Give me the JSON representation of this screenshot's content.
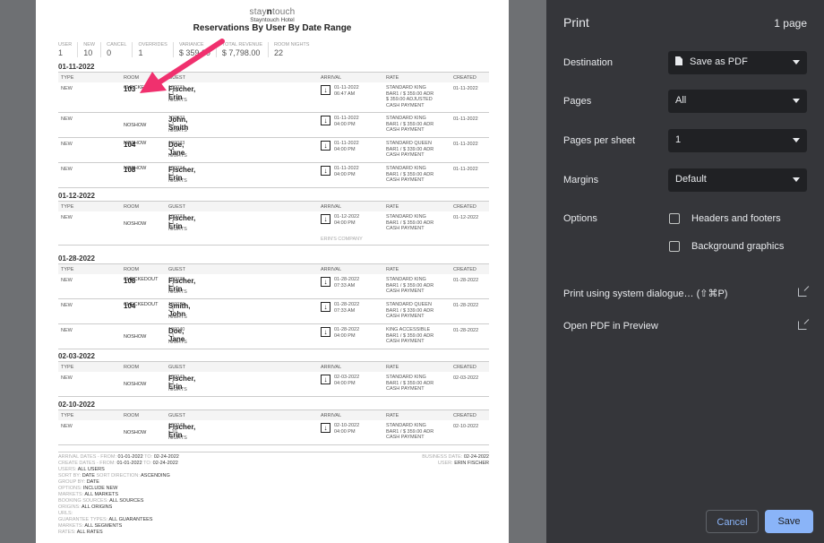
{
  "report": {
    "brand_prefix": "stay",
    "brand_mid": "n",
    "brand_suffix": "touch",
    "hotel": "Stayntouch Hotel",
    "title": "Reservations By User By Date Range"
  },
  "stats": [
    {
      "label": "USER",
      "value": "1"
    },
    {
      "label": "NEW",
      "value": "10"
    },
    {
      "label": "CANCEL",
      "value": "0"
    },
    {
      "label": "OVERRIDES",
      "value": "1"
    },
    {
      "label": "VARIANCE",
      "value": "$ 359.00"
    },
    {
      "label": "TOTAL REVENUE",
      "value": "$ 7,798.00"
    },
    {
      "label": "ROOM NIGHTS",
      "value": "22"
    }
  ],
  "columns": {
    "type": "TYPE",
    "room": "ROOM",
    "guest": "GUEST",
    "arrival": "ARRIVAL",
    "rate": "RATE",
    "created": "CREATED"
  },
  "sections": [
    {
      "date": "01-11-2022",
      "rows": [
        {
          "type": "NEW",
          "room": "103",
          "status": "CHECKEDOUT",
          "guest": "Fischer, Erin",
          "gid": "100031 • 1 NIGHTS",
          "arr_date": "01-11-2022",
          "arr_time": "06:47 AM",
          "rate": [
            "STANDARD KING",
            "BAR1 / $ 359.00 ADR",
            "$ 359.00 ADJUSTED",
            "CASH PAYMENT"
          ],
          "created": "01-11-2022"
        },
        {
          "type": "NEW",
          "room": "",
          "status": "NOSHOW",
          "guest": "John, Smith",
          "gid": "100032 • 1 NIGHTS",
          "arr_date": "01-11-2022",
          "arr_time": "04:00 PM",
          "rate": [
            "STANDARD KING",
            "BAR1 / $ 359.00 ADR",
            "CASH PAYMENT"
          ],
          "created": "01-11-2022"
        },
        {
          "type": "NEW",
          "room": "104",
          "status": "NOSHOW",
          "guest": "Doe, Jane",
          "gid": "100033 • 4 NIGHTS",
          "arr_date": "01-11-2022",
          "arr_time": "04:00 PM",
          "rate": [
            "STANDARD QUEEN",
            "BAR1 / $ 339.00 ADR",
            "CASH PAYMENT"
          ],
          "created": "01-11-2022"
        },
        {
          "type": "NEW",
          "room": "108",
          "status": "NOSHOW",
          "guest": "Fischer, Erin",
          "gid": "100034 • 1 NIGHTS",
          "arr_date": "01-11-2022",
          "arr_time": "04:00 PM",
          "rate": [
            "STANDARD KING",
            "BAR1 / $ 359.00 ADR",
            "CASH PAYMENT"
          ],
          "created": "01-11-2022"
        }
      ]
    },
    {
      "date": "01-12-2022",
      "rows": [
        {
          "type": "NEW",
          "room": "",
          "status": "NOSHOW",
          "guest": "Fischer, Erin",
          "gid": "100037 • 1 NIGHTS",
          "arr_date": "01-12-2022",
          "arr_time": "04:00 PM",
          "rate": [
            "STANDARD KING",
            "BAR1 / $ 359.00 ADR",
            "CASH PAYMENT"
          ],
          "created": "01-12-2022",
          "company": "ERIN'S COMPANY"
        }
      ]
    },
    {
      "date": "01-28-2022",
      "rows": [
        {
          "type": "NEW",
          "room": "108",
          "status": "CHECKEDOUT",
          "guest": "Fischer, Erin",
          "gid": "100038 • 1 NIGHTS",
          "arr_date": "01-28-2022",
          "arr_time": "07:33 AM",
          "rate": [
            "STANDARD KING",
            "BAR1 / $ 359.00 ADR",
            "CASH PAYMENT"
          ],
          "created": "01-28-2022"
        },
        {
          "type": "NEW",
          "room": "104",
          "status": "CHECKEDOUT",
          "guest": "Smith, John",
          "gid": "100039 • 1 NIGHTS",
          "arr_date": "01-28-2022",
          "arr_time": "07:33 AM",
          "rate": [
            "STANDARD QUEEN",
            "BAR1 / $ 339.00 ADR",
            "CASH PAYMENT"
          ],
          "created": "01-28-2022"
        },
        {
          "type": "NEW",
          "room": "",
          "status": "NOSHOW",
          "guest": "Doe, Jane",
          "gid": "100040 • 1 NIGHTS",
          "arr_date": "01-28-2022",
          "arr_time": "04:00 PM",
          "rate": [
            "KING ACCESSIBLE",
            "BAR1 / $ 359.00 ADR",
            "CASH PAYMENT"
          ],
          "created": "01-28-2022"
        }
      ]
    },
    {
      "date": "02-03-2022",
      "rows": [
        {
          "type": "NEW",
          "room": "",
          "status": "NOSHOW",
          "guest": "Fischer, Erin",
          "gid": "100041 • 1 NIGHTS",
          "arr_date": "02-03-2022",
          "arr_time": "04:00 PM",
          "rate": [
            "STANDARD KING",
            "BAR1 / $ 359.00 ADR",
            "CASH PAYMENT"
          ],
          "created": "02-03-2022"
        }
      ]
    },
    {
      "date": "02-10-2022",
      "rows": [
        {
          "type": "NEW",
          "room": "",
          "status": "NOSHOW",
          "guest": "Fischer, Erin",
          "gid": "100042 • 10 NIGHTS",
          "arr_date": "02-10-2022",
          "arr_time": "04:00 PM",
          "rate": [
            "STANDARD KING",
            "BAR1 / $ 359.00 ADR",
            "CASH PAYMENT"
          ],
          "created": "02-10-2022"
        }
      ]
    }
  ],
  "footer": {
    "lines": [
      [
        {
          "k": "ARRIVAL DATES - FROM: "
        },
        {
          "v": "01-01-2022"
        },
        {
          "k": " TO: "
        },
        {
          "v": "02-24-2022"
        }
      ],
      [
        {
          "k": "CREATE DATES - FROM: "
        },
        {
          "v": "01-01-2022"
        },
        {
          "k": " TO: "
        },
        {
          "v": "02-24-2022"
        }
      ],
      [
        {
          "k": "USERS: "
        },
        {
          "v": "ALL USERS"
        }
      ],
      [
        {
          "k": "SORT BY: "
        },
        {
          "v": "DATE"
        },
        {
          "k": " SORT DIRECTION: "
        },
        {
          "v": "ASCENDING"
        }
      ],
      [
        {
          "k": "GROUP BY: "
        },
        {
          "v": "DATE"
        }
      ],
      [
        {
          "k": "OPTIONS: "
        },
        {
          "v": "INCLUDE NEW"
        }
      ],
      [
        {
          "k": "MARKETS: "
        },
        {
          "v": "ALL MARKETS"
        }
      ],
      [
        {
          "k": "BOOKING SOURCES: "
        },
        {
          "v": "ALL SOURCES"
        }
      ],
      [
        {
          "k": "ORIGINS: "
        },
        {
          "v": "ALL ORIGINS"
        }
      ],
      [
        {
          "k": "URLS: "
        }
      ],
      [
        {
          "k": "GUARANTEE TYPES: "
        },
        {
          "v": "ALL GUARANTEES"
        }
      ],
      [
        {
          "k": "MARKETS: "
        },
        {
          "v": "ALL SEGMENTS"
        }
      ],
      [
        {
          "k": "RATES: "
        },
        {
          "v": "ALL RATES"
        }
      ]
    ],
    "right_lines": [
      [
        {
          "k": "BUSINESS DATE: "
        },
        {
          "v": "02-24-2022"
        }
      ],
      [
        {
          "k": "USER: "
        },
        {
          "v": "ERIN FISCHER"
        }
      ]
    ]
  },
  "print_panel": {
    "title": "Print",
    "page_count": "1 page",
    "destination_label": "Destination",
    "destination_value": "Save as PDF",
    "pages_label": "Pages",
    "pages_value": "All",
    "pps_label": "Pages per sheet",
    "pps_value": "1",
    "margins_label": "Margins",
    "margins_value": "Default",
    "options_label": "Options",
    "opt_headers": "Headers and footers",
    "opt_background": "Background graphics",
    "system_dialog": "Print using system dialogue… (⇧⌘P)",
    "open_pdf": "Open PDF in Preview",
    "cancel": "Cancel",
    "save": "Save"
  },
  "colors": {
    "accent": "#8ab4f8",
    "annotation": "#f0306e",
    "panel_bg": "#35363a"
  }
}
